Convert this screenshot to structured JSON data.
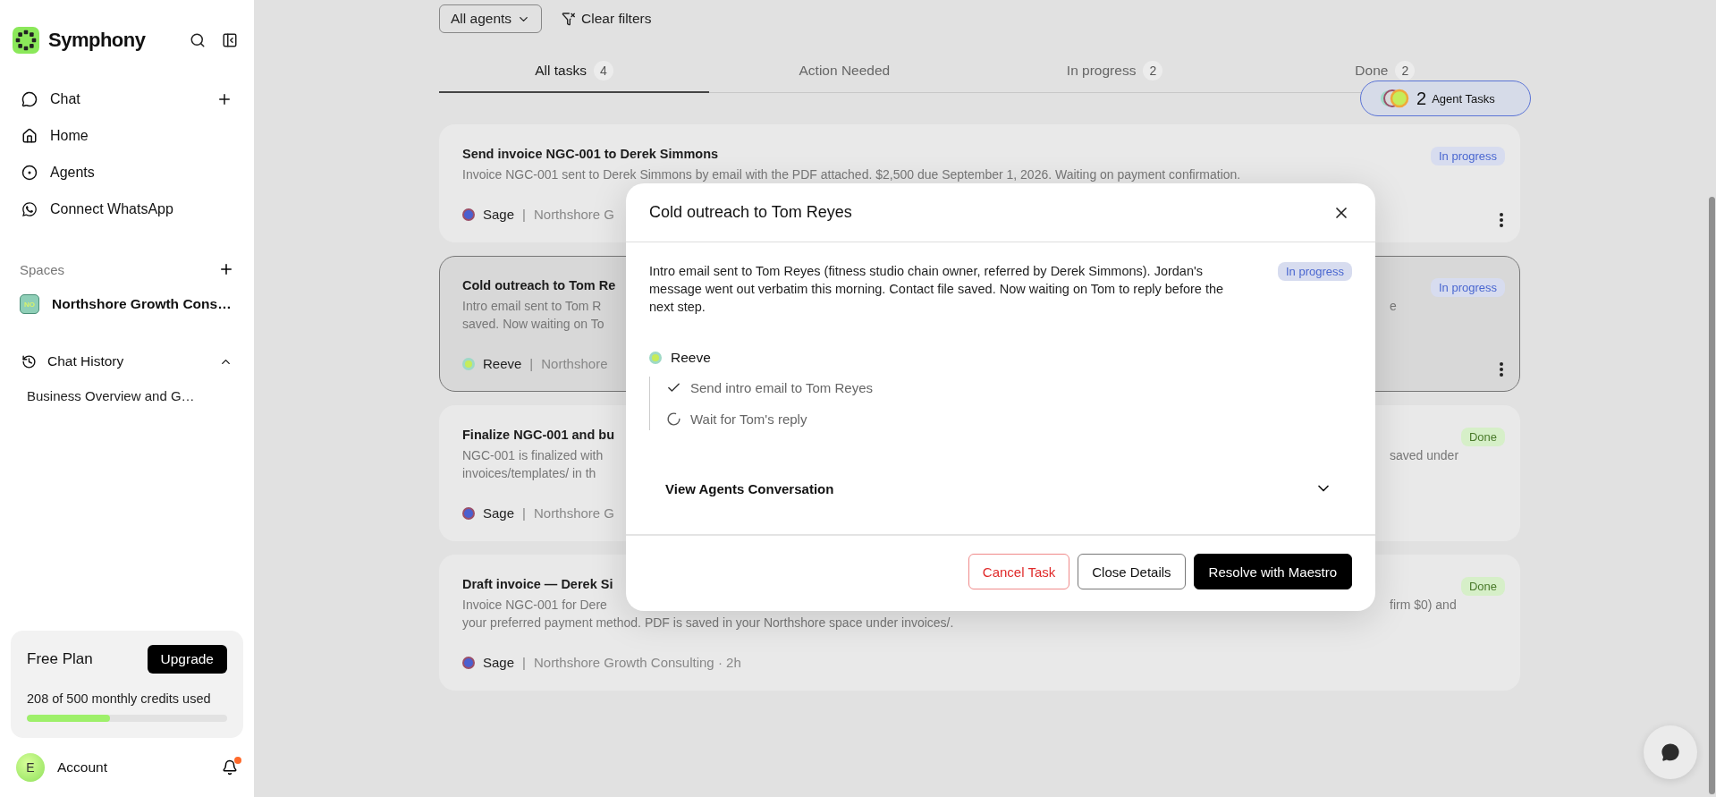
{
  "sidebar": {
    "brand": "Symphony",
    "nav": [
      {
        "label": "Chat",
        "kind": "chat",
        "addable": true
      },
      {
        "label": "Home",
        "kind": "home",
        "addable": false
      },
      {
        "label": "Agents",
        "kind": "agents",
        "addable": false
      },
      {
        "label": "Connect WhatsApp",
        "kind": "whatsapp",
        "addable": false
      }
    ],
    "spaces": {
      "label": "Spaces",
      "items": [
        {
          "initials": "NO",
          "name": "Northshore Growth Cons…"
        }
      ]
    },
    "chat_history": {
      "label": "Chat History",
      "expanded": true,
      "items": [
        "Business Overview and G…"
      ]
    },
    "plan": {
      "name": "Free Plan",
      "button": "Upgrade",
      "usage": "208 of 500 monthly credits used",
      "level": 0.416
    },
    "account": {
      "initial": "E",
      "label": "Account",
      "unread": true
    }
  },
  "filters": {
    "agent_select": "All agents",
    "clear": "Clear filters"
  },
  "tabs": [
    {
      "label": "All tasks",
      "count": "4",
      "selected": true
    },
    {
      "label": "Action Needed",
      "selected": false
    },
    {
      "label": "In progress",
      "count": "2",
      "selected": false
    },
    {
      "label": "Done",
      "count": "2",
      "selected": false
    }
  ],
  "agent_tasks": {
    "count": "2",
    "label": "Agent Tasks"
  },
  "cards": [
    {
      "title": "Send invoice NGC-001 to Derek Simmons",
      "selected": false,
      "menu": true,
      "lines": [
        {
          "left": "Invoice NGC-001 sent to Derek Simmons by email with the PDF attached. $2,500 due September 1, 2026. Waiting on payment confirmation."
        }
      ],
      "status": {
        "label": "In progress",
        "kind": "in_progress"
      },
      "meta": {
        "agent": "Sage",
        "color": "#4a5fd0",
        "separator": "|",
        "space": "Northshore G"
      }
    },
    {
      "title": "Cold outreach to Tom Re",
      "selected": true,
      "menu": true,
      "lines": [
        {
          "left": "Intro email sent to Tom R",
          "right": "e"
        },
        {
          "left": "saved. Now waiting on To"
        }
      ],
      "status": {
        "label": "In progress",
        "kind": "in_progress"
      },
      "meta": {
        "agent": "Reeve",
        "color": "#c6ec5a",
        "separator": "|",
        "space": "Northshore"
      }
    },
    {
      "title": "Finalize NGC-001 and bu",
      "selected": false,
      "menu": false,
      "lines": [
        {
          "left": "NGC-001 is finalized with",
          "right": "saved under"
        },
        {
          "left": "invoices/templates/ in th"
        }
      ],
      "status": {
        "label": "Done",
        "kind": "done"
      },
      "meta": {
        "agent": "Sage",
        "color": "#4a5fd0",
        "separator": "|",
        "space": "Northshore G"
      }
    },
    {
      "title": "Draft invoice — Derek Si",
      "selected": false,
      "menu": false,
      "lines": [
        {
          "left": "Invoice NGC-001 for Dere",
          "right": "firm $0) and"
        },
        {
          "left": "your preferred payment method. PDF is saved in your Northshore space under invoices/."
        }
      ],
      "status": {
        "label": "Done",
        "kind": "done"
      },
      "meta": {
        "agent": "Sage",
        "color": "#4a5fd0",
        "separator": "|",
        "space": "Northshore Growth Consulting · 2h"
      }
    }
  ],
  "modal": {
    "title": "Cold outreach to Tom Reyes",
    "description": "Intro email sent to Tom Reyes (fitness studio chain owner, referred by Derek Simmons). Jordan's message went out verbatim this morning. Contact file saved. Now waiting on Tom to reply before the next step.",
    "status": {
      "label": "In progress",
      "kind": "in_progress"
    },
    "agent": {
      "name": "Reeve",
      "color": "#c6ec5a"
    },
    "steps": [
      {
        "label": "Send intro email to Tom Reyes",
        "done": true
      },
      {
        "label": "Wait for Tom's reply",
        "done": false
      }
    ],
    "conversation": {
      "label": "View Agents Conversation",
      "expanded": false
    },
    "buttons": [
      {
        "label": "Cancel Task",
        "kind": "danger"
      },
      {
        "label": "Close Details",
        "kind": "secondary"
      },
      {
        "label": "Resolve with Maestro",
        "kind": "primary"
      }
    ]
  }
}
